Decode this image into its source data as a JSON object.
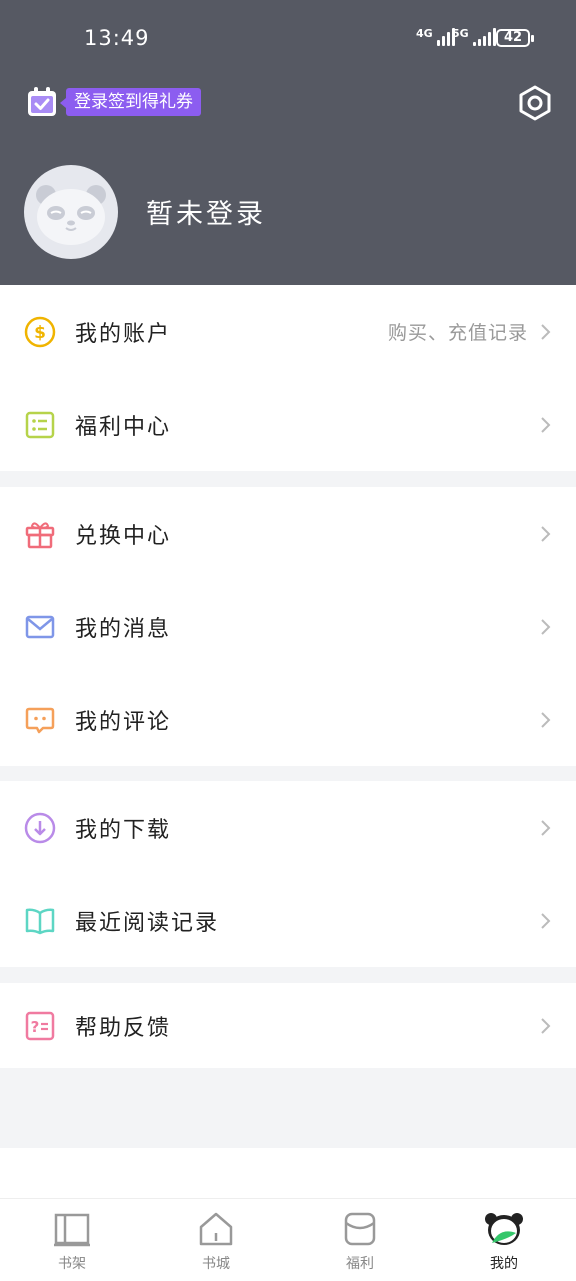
{
  "status_bar": {
    "time": "13:49",
    "signal1": "4G",
    "signal2": "5G",
    "battery": "42"
  },
  "header": {
    "checkin_label": "登录签到得礼券",
    "login_text": "暂未登录"
  },
  "menu": {
    "account": {
      "label": "我的账户",
      "extra": "购买、充值记录"
    },
    "welfare_center": {
      "label": "福利中心"
    },
    "exchange": {
      "label": "兑换中心"
    },
    "messages": {
      "label": "我的消息"
    },
    "comments": {
      "label": "我的评论"
    },
    "downloads": {
      "label": "我的下载"
    },
    "history": {
      "label": "最近阅读记录"
    },
    "help": {
      "label": "帮助反馈"
    }
  },
  "tabs": {
    "shelf": "书架",
    "store": "书城",
    "welfare": "福利",
    "mine": "我的"
  },
  "colors": {
    "header_bg": "#565963",
    "badge_purple": "#8c5df0",
    "account_icon": "#f0b400",
    "welfare_icon": "#b6d34a",
    "exchange_icon": "#f06c7a",
    "messages_icon": "#7f96e8",
    "comments_icon": "#f5a05a",
    "downloads_icon": "#b98be8",
    "history_icon": "#5dd6c4",
    "help_icon": "#f07aa0"
  }
}
